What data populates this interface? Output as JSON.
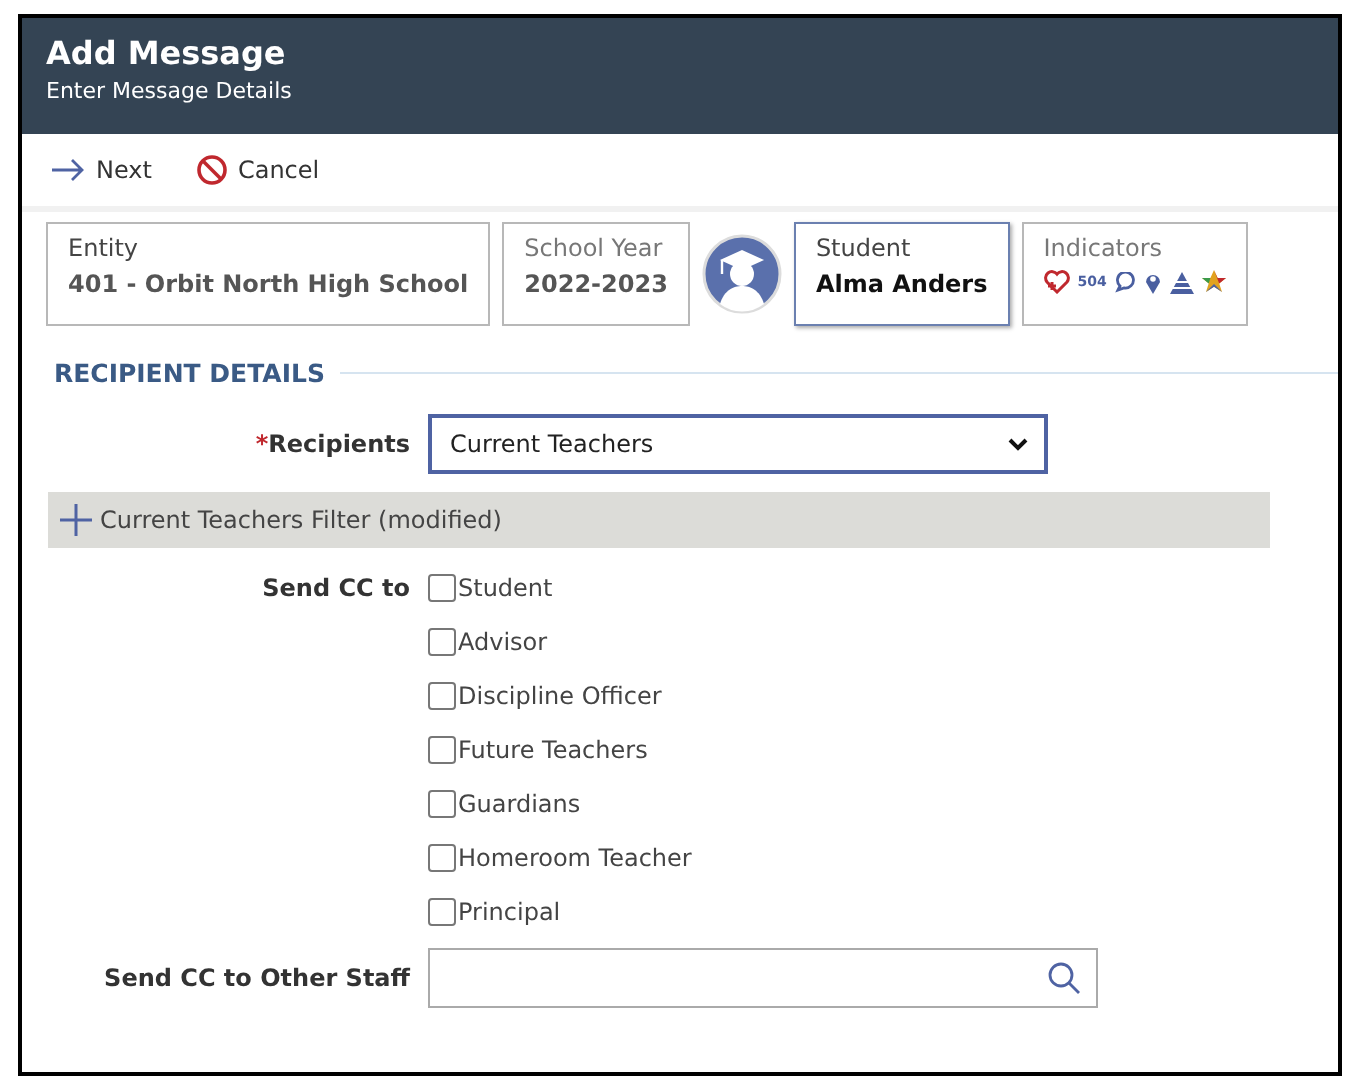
{
  "header": {
    "title": "Add Message",
    "subtitle": "Enter Message Details"
  },
  "toolbar": [
    {
      "kind": "next",
      "label": "Next"
    },
    {
      "kind": "cancel",
      "label": "Cancel"
    }
  ],
  "context": {
    "entity": {
      "label": "Entity",
      "value": "401 - Orbit North High School"
    },
    "school_year": {
      "label": "School Year",
      "value": "2022-2023"
    },
    "student": {
      "label": "Student",
      "value": "Alma Anders"
    },
    "indicators": {
      "label": "Indicators",
      "badge": "504"
    }
  },
  "section": {
    "title": "RECIPIENT DETAILS"
  },
  "recipients": {
    "required_mark": "*",
    "label": "Recipients",
    "value": "Current Teachers"
  },
  "filter": {
    "label": "Current Teachers Filter (modified)",
    "expanded": false
  },
  "send_cc": {
    "label": "Send CC to",
    "options": [
      {
        "label": "Student",
        "checked": false
      },
      {
        "label": "Advisor",
        "checked": false
      },
      {
        "label": "Discipline Officer",
        "checked": false
      },
      {
        "label": "Future Teachers",
        "checked": false
      },
      {
        "label": "Guardians",
        "checked": false
      },
      {
        "label": "Homeroom Teacher",
        "checked": false
      },
      {
        "label": "Principal",
        "checked": false
      }
    ]
  },
  "other_staff": {
    "label": "Send CC to Other Staff"
  }
}
